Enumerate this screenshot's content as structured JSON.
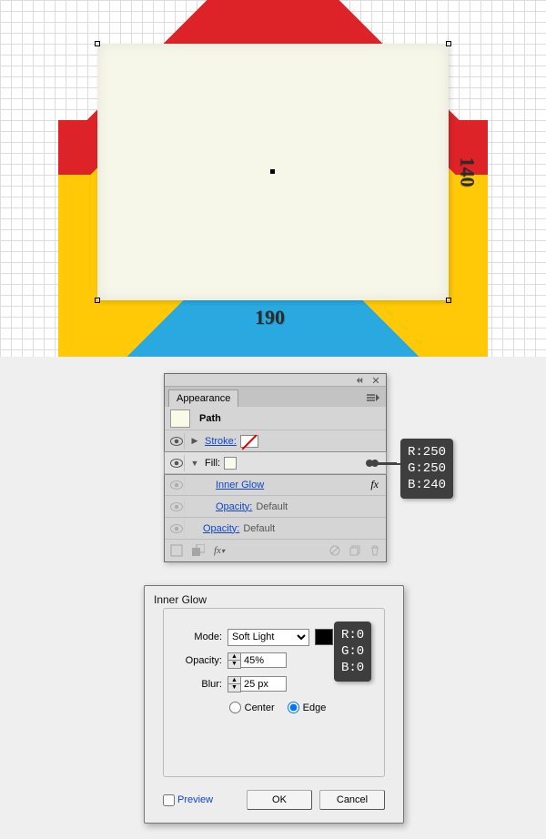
{
  "canvas": {
    "width_label": "190",
    "height_label": "140"
  },
  "appearance": {
    "panel_title": "Appearance",
    "object_type": "Path",
    "stroke_label": "Stroke:",
    "fill_label": "Fill:",
    "effect1": "Inner Glow",
    "fx_symbol": "fx",
    "opacity_label": "Opacity:",
    "opacity_value": "Default"
  },
  "rgb_fill": {
    "r": "R:250",
    "g": "G:250",
    "b": "B:240"
  },
  "dialog": {
    "title": "Inner Glow",
    "mode_label": "Mode:",
    "mode_value": "Soft Light",
    "opacity_label": "Opacity:",
    "opacity_value": "45%",
    "blur_label": "Blur:",
    "blur_value": "25 px",
    "center_label": "Center",
    "edge_label": "Edge",
    "preview_label": "Preview",
    "ok_label": "OK",
    "cancel_label": "Cancel"
  },
  "rgb_glow": {
    "r": "R:0",
    "g": "G:0",
    "b": "B:0"
  }
}
